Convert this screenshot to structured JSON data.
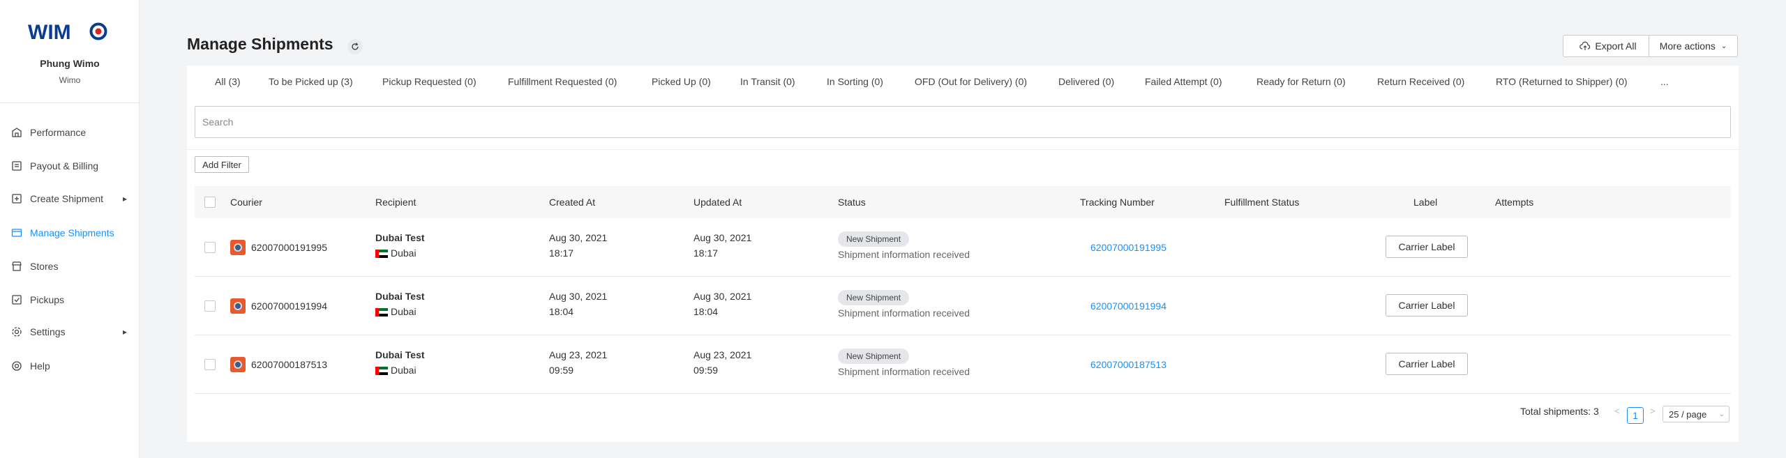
{
  "brand": {
    "logo_text": "WIMO",
    "accent": "#1890ff",
    "logo_color": "#0a3d91",
    "logo_mark_color": "#e31e24"
  },
  "user": {
    "name": "Phung Wimo",
    "company": "Wimo"
  },
  "sidebar": {
    "items": [
      {
        "label": "Performance",
        "icon": "performance-icon",
        "active": false,
        "has_submenu": false
      },
      {
        "label": "Payout & Billing",
        "icon": "billing-icon",
        "active": false,
        "has_submenu": false
      },
      {
        "label": "Create Shipment",
        "icon": "create-shipment-icon",
        "active": false,
        "has_submenu": true
      },
      {
        "label": "Manage Shipments",
        "icon": "shipments-icon",
        "active": true,
        "has_submenu": false
      },
      {
        "label": "Stores",
        "icon": "store-icon",
        "active": false,
        "has_submenu": false
      },
      {
        "label": "Pickups",
        "icon": "pickup-icon",
        "active": false,
        "has_submenu": false
      },
      {
        "label": "Settings",
        "icon": "gear-icon",
        "active": false,
        "has_submenu": true
      },
      {
        "label": "Help",
        "icon": "help-icon",
        "active": false,
        "has_submenu": false
      }
    ]
  },
  "header": {
    "title": "Manage Shipments",
    "export_label": "Export All",
    "more_label": "More actions"
  },
  "tabs": [
    "All (3)",
    "To be Picked up (3)",
    "Pickup Requested (0)",
    "Fulfillment Requested (0)",
    "Picked Up (0)",
    "In Transit (0)",
    "In Sorting (0)",
    "OFD (Out for Delivery) (0)",
    "Delivered (0)",
    "Failed Attempt (0)",
    "Ready for Return (0)",
    "Return Received (0)",
    "RTO (Returned to Shipper) (0)",
    "..."
  ],
  "search": {
    "placeholder": "Search",
    "value": ""
  },
  "filter": {
    "add_label": "Add Filter"
  },
  "table": {
    "columns": [
      "Courier",
      "Recipient",
      "Created At",
      "Updated At",
      "Status",
      "Tracking Number",
      "Fulfillment Status",
      "Label",
      "Attempts"
    ],
    "rows": [
      {
        "courier_id": "62007000191995",
        "recipient_name": "Dubai Test",
        "recipient_city": "Dubai",
        "created_date": "Aug 30, 2021",
        "created_time": "18:17",
        "updated_date": "Aug 30, 2021",
        "updated_time": "18:17",
        "status": "New Shipment",
        "status_desc": "Shipment information received",
        "tracking": "62007000191995",
        "fulfillment": "",
        "label_button": "Carrier Label",
        "attempts": ""
      },
      {
        "courier_id": "62007000191994",
        "recipient_name": "Dubai Test",
        "recipient_city": "Dubai",
        "created_date": "Aug 30, 2021",
        "created_time": "18:04",
        "updated_date": "Aug 30, 2021",
        "updated_time": "18:04",
        "status": "New Shipment",
        "status_desc": "Shipment information received",
        "tracking": "62007000191994",
        "fulfillment": "",
        "label_button": "Carrier Label",
        "attempts": ""
      },
      {
        "courier_id": "62007000187513",
        "recipient_name": "Dubai Test",
        "recipient_city": "Dubai",
        "created_date": "Aug 23, 2021",
        "created_time": "09:59",
        "updated_date": "Aug 23, 2021",
        "updated_time": "09:59",
        "status": "New Shipment",
        "status_desc": "Shipment information received",
        "tracking": "62007000187513",
        "fulfillment": "",
        "label_button": "Carrier Label",
        "attempts": ""
      }
    ]
  },
  "pagination": {
    "total_label": "Total shipments: 3",
    "current_page": "1",
    "page_size": "25 / page",
    "prev": "<",
    "next": ">"
  }
}
